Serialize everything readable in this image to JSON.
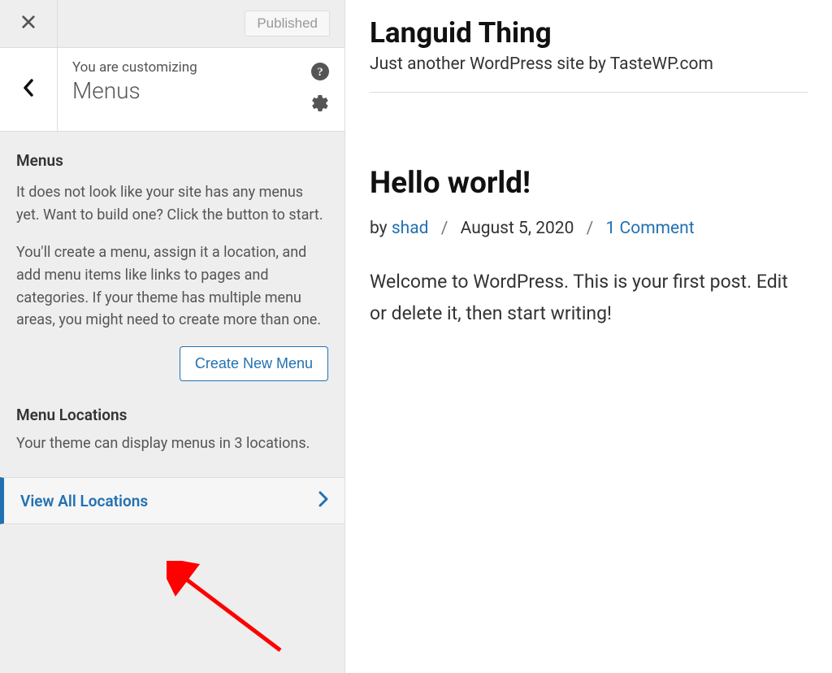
{
  "sidebar": {
    "published_label": "Published",
    "customizing_label": "You are customizing",
    "section_title": "Menus",
    "menus_heading": "Menus",
    "menus_p1": "It does not look like your site has any menus yet. Want to build one? Click the button to start.",
    "menus_p2": "You'll create a menu, assign it a location, and add menu items like links to pages and categories. If your theme has multiple menu areas, you might need to create more than one.",
    "create_menu_label": "Create New Menu",
    "locations_heading": "Menu Locations",
    "locations_p": "Your theme can display menus in 3 locations.",
    "view_all_label": "View All Locations"
  },
  "preview": {
    "site_title": "Languid Thing",
    "site_tagline": "Just another WordPress site by TasteWP.com",
    "post_title": "Hello world!",
    "meta_by": "by ",
    "meta_author": "shad",
    "meta_date": "August 5, 2020",
    "meta_comments": "1 Comment",
    "post_body": "Welcome to WordPress. This is your first post. Edit or delete it, then start writing!"
  }
}
